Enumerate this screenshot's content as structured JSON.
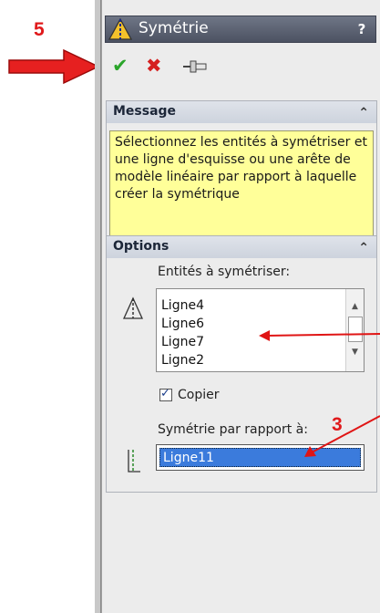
{
  "annotations": {
    "step_top": "5",
    "step_right": "3"
  },
  "window": {
    "title": "Symétrie",
    "help": "?"
  },
  "toolbar": {
    "ok": "✔",
    "cancel": "✖",
    "pin": "pin-icon"
  },
  "message": {
    "header": "Message",
    "text": "Sélectionnez les entités à symétriser et une ligne d'esquisse ou une arête de modèle linéaire par rapport à laquelle créer la symétrique"
  },
  "options": {
    "header": "Options",
    "entities_label": "Entités à symétriser:",
    "entities": [
      "Ligne4",
      "Ligne6",
      "Ligne7",
      "Ligne2"
    ],
    "copy_label": "Copier",
    "copy_checked": true,
    "mirror_label": "Symétrie par rapport à:",
    "mirror_value": "Ligne11"
  },
  "colors": {
    "accent_red": "#e0191b",
    "selection_blue": "#3b7bdc",
    "message_yellow": "#ffff99"
  }
}
